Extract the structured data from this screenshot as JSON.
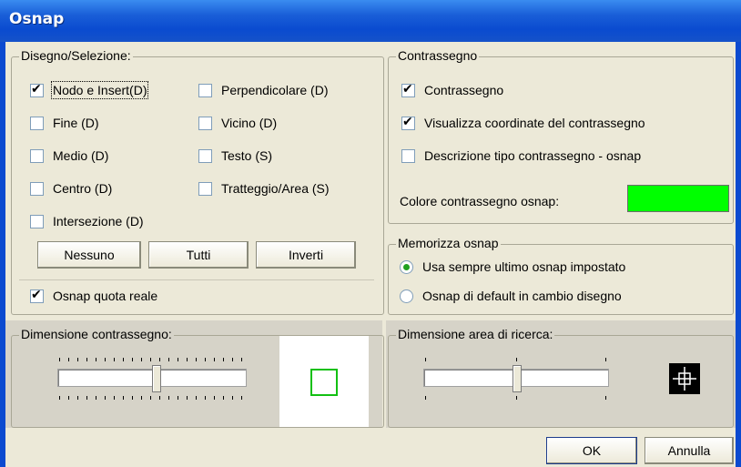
{
  "window": {
    "title": "Osnap"
  },
  "colors": {
    "marker": "#00ff00",
    "accent_check": "#21a121"
  },
  "disegno": {
    "legend": "Disegno/Selezione:",
    "left": [
      {
        "label": "Nodo e Insert(D)",
        "checked": true
      },
      {
        "label": "Fine (D)",
        "checked": false
      },
      {
        "label": "Medio (D)",
        "checked": false
      },
      {
        "label": "Centro (D)",
        "checked": false
      },
      {
        "label": "Intersezione (D)",
        "checked": false
      }
    ],
    "right": [
      {
        "label": "Perpendicolare (D)",
        "checked": false
      },
      {
        "label": "Vicino (D)",
        "checked": false
      },
      {
        "label": "Testo (S)",
        "checked": false
      },
      {
        "label": "Tratteggio/Area (S)",
        "checked": false
      }
    ],
    "buttons": {
      "none": "Nessuno",
      "all": "Tutti",
      "invert": "Inverti"
    },
    "osnap_quota": {
      "label": "Osnap quota reale",
      "checked": true
    }
  },
  "contrassegno": {
    "legend": "Contrassegno",
    "items": [
      {
        "label": "Contrassegno",
        "checked": true
      },
      {
        "label": "Visualizza coordinate del contrassegno",
        "checked": true
      },
      {
        "label": "Descrizione tipo contrassegno - osnap",
        "checked": false
      }
    ],
    "color_label": "Colore contrassegno osnap:"
  },
  "memorizza": {
    "legend": "Memorizza osnap",
    "options": [
      {
        "label": "Usa sempre ultimo osnap impostato",
        "selected": true
      },
      {
        "label": "Osnap di default in cambio disegno",
        "selected": false
      }
    ]
  },
  "dim_contrassegno": {
    "legend": "Dimensione contrassegno:"
  },
  "dim_area": {
    "legend": "Dimensione area di ricerca:"
  },
  "footer": {
    "ok": "OK",
    "cancel": "Annulla"
  }
}
